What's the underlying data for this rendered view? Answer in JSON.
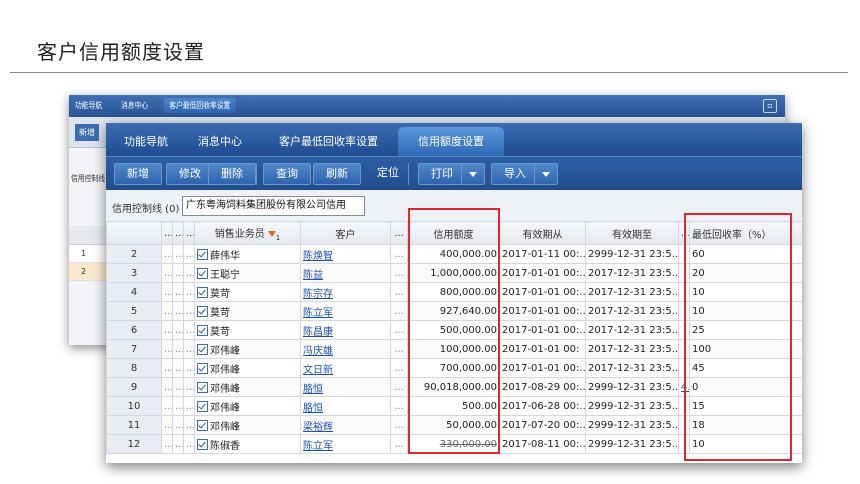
{
  "slide": {
    "title": "客户信用额度设置"
  },
  "back_window": {
    "tabs": [
      "功能导航",
      "消息中心",
      "客户最低回收率设置"
    ],
    "close_icon": "maximize-icon",
    "new_button": "新增",
    "filter_label": "信用控制线 (l",
    "rows": [
      "1",
      "2"
    ]
  },
  "window": {
    "tabs": [
      {
        "label": "功能导航",
        "active": false
      },
      {
        "label": "消息中心",
        "active": false
      },
      {
        "label": "客户最低回收率设置",
        "active": false
      },
      {
        "label": "信用额度设置",
        "active": true
      }
    ],
    "toolbar": {
      "new": "新增",
      "edit": "修改",
      "delete": "删除",
      "query": "查询",
      "refresh": "刷新",
      "locate": "定位",
      "print": "打印",
      "import": "导入"
    },
    "filter": {
      "label": "信用控制线 (0)",
      "value": "广东粤海饲料集团股份有限公司信用"
    },
    "columns": {
      "salesperson": "销售业务员",
      "sort_badge": "1",
      "customer": "客户",
      "credit_limit": "信用额度",
      "valid_from": "有效期从",
      "valid_to": "有效期至",
      "min_rate": "最低回收率（%）"
    },
    "rows": [
      {
        "n": "2",
        "sales": "薛伟华",
        "customer": "陈焕智",
        "limit": "400,000.00",
        "from": "2017-01-11 00:...",
        "to": "2999-12-31 23:5...",
        "extra": "",
        "rate": "60"
      },
      {
        "n": "3",
        "sales": "王聪宁",
        "customer": "陈益",
        "limit": "1,000,000.00",
        "from": "2017-01-01 00:...",
        "to": "2017-12-31 23:5...",
        "extra": "",
        "rate": "20"
      },
      {
        "n": "4",
        "sales": "莫苛",
        "customer": "陈宗存",
        "limit": "800,000.00",
        "from": "2017-01-01 00:...",
        "to": "2017-12-31 23:5...",
        "extra": "",
        "rate": "10"
      },
      {
        "n": "5",
        "sales": "莫苛",
        "customer": "陈立军",
        "limit": "927,640.00",
        "from": "2017-01-01 00:...",
        "to": "2017-12-31 23:5...",
        "extra": "",
        "rate": "10"
      },
      {
        "n": "6",
        "sales": "莫苛",
        "customer": "陈昌康",
        "limit": "500,000.00",
        "from": "2017-01-01 00:...",
        "to": "2017-12-31 23:5...",
        "extra": "",
        "rate": "25"
      },
      {
        "n": "7",
        "sales": "邓伟峰",
        "customer": "冯庆雄",
        "limit": "100,000.00",
        "from": "2017-01-01 00:",
        "to": "2017-12-31 23:5...",
        "extra": "",
        "rate": "100"
      },
      {
        "n": "8",
        "sales": "邓伟峰",
        "customer": "文日新",
        "limit": "700,000.00",
        "from": "2017-01-01 00:...",
        "to": "2017-12-31 23:5...",
        "extra": "",
        "rate": "45"
      },
      {
        "n": "9",
        "sales": "邓伟峰",
        "customer": "胳恒",
        "limit": "90,018,000.00",
        "from": "2017-08-29 00:...",
        "to": "2999-12-31 23:5...",
        "extra": "4.",
        "rate": "0"
      },
      {
        "n": "10",
        "sales": "邓伟峰",
        "customer": "胳恒",
        "limit": "500.00",
        "from": "2017-06-28 00:...",
        "to": "2999-12-31 23:5...",
        "extra": "",
        "rate": "15"
      },
      {
        "n": "11",
        "sales": "邓伟峰",
        "customer": "梁裕辉",
        "limit": "50,000.00",
        "from": "2017-07-20 00:...",
        "to": "2999-12-31 23:5...",
        "extra": "",
        "rate": "18"
      },
      {
        "n": "12",
        "sales": "陈俶香",
        "customer": "陈立军",
        "limit": "330,000.00",
        "from": "2017-08-11 00:...",
        "to": "2999-12-31 23:5...",
        "extra": "",
        "rate": "10"
      }
    ]
  },
  "colors": {
    "accent": "#2a5aa3",
    "highlight": "#e0262e",
    "sort": "#e06a10"
  }
}
